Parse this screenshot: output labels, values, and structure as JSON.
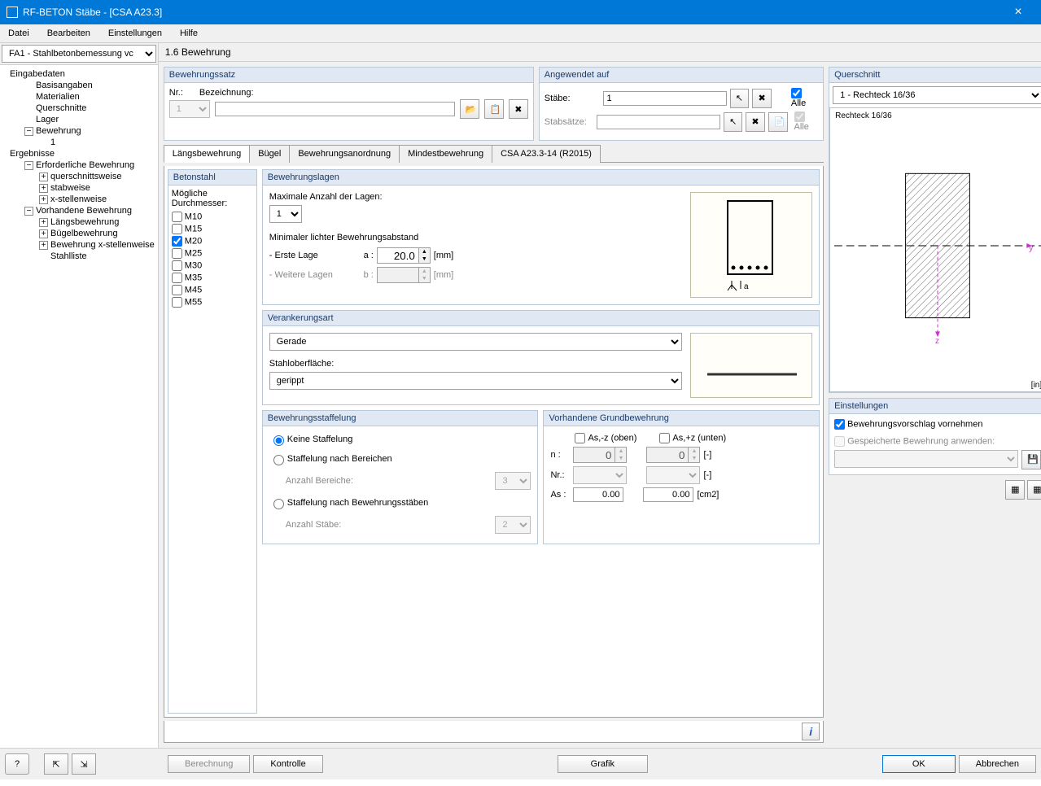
{
  "window": {
    "title": "RF-BETON Stäbe - [CSA A23.3]"
  },
  "menu": {
    "file": "Datei",
    "edit": "Bearbeiten",
    "settings": "Einstellungen",
    "help": "Hilfe"
  },
  "caseSelector": {
    "value": "FA1 - Stahlbetonbemessung vc"
  },
  "tree": {
    "eingabedaten": "Eingabedaten",
    "basisangaben": "Basisangaben",
    "materialien": "Materialien",
    "querschnitte": "Querschnitte",
    "lager": "Lager",
    "bewehrung": "Bewehrung",
    "bewehrung1": "1",
    "ergebnisse": "Ergebnisse",
    "erforderliche": "Erforderliche Bewehrung",
    "querschnittsweise": "querschnittsweise",
    "stabweise": "stabweise",
    "xstellenweise": "x-stellenweise",
    "vorhandene": "Vorhandene Bewehrung",
    "laengsbewehrung": "Längsbewehrung",
    "buegelbewehrung": "Bügelbewehrung",
    "bewxstellen": "Bewehrung x-stellenweise",
    "stahlliste": "Stahlliste"
  },
  "page": {
    "title": "1.6 Bewehrung"
  },
  "bewehrungssatz": {
    "title": "Bewehrungssatz",
    "nrLabel": "Nr.:",
    "nrValue": "1",
    "bezLabel": "Bezeichnung:",
    "bezValue": ""
  },
  "angewendet": {
    "title": "Angewendet auf",
    "staebeLabel": "Stäbe:",
    "staebeValue": "1",
    "alleLabel": "Alle",
    "stabsaetzeLabel": "Stabsätze:",
    "stabsaetzeValue": ""
  },
  "tabs": {
    "t1": "Längsbewehrung",
    "t2": "Bügel",
    "t3": "Bewehrungsanordnung",
    "t4": "Mindestbewehrung",
    "t5": "CSA A23.3-14 (R2015)"
  },
  "betonstahl": {
    "title": "Betonstahl",
    "sublabel": "Mögliche Durchmesser:",
    "items": [
      {
        "label": "M10",
        "checked": false
      },
      {
        "label": "M15",
        "checked": false
      },
      {
        "label": "M20",
        "checked": true
      },
      {
        "label": "M25",
        "checked": false
      },
      {
        "label": "M30",
        "checked": false
      },
      {
        "label": "M35",
        "checked": false
      },
      {
        "label": "M45",
        "checked": false
      },
      {
        "label": "M55",
        "checked": false
      }
    ]
  },
  "lagen": {
    "title": "Bewehrungslagen",
    "maxLabel": "Maximale Anzahl der Lagen:",
    "maxValue": "1",
    "minAbstand": "Minimaler lichter Bewehrungsabstand",
    "ersteLage": "- Erste Lage",
    "aLabel": "a :",
    "aValue": "20.0",
    "unitMm": "[mm]",
    "weitere": "- Weitere Lagen",
    "bLabel": "b :",
    "bValue": ""
  },
  "verankerung": {
    "title": "Verankerungsart",
    "value": "Gerade",
    "oberflaecheLabel": "Stahloberfläche:",
    "oberflaecheValue": "gerippt"
  },
  "staffelung": {
    "title": "Bewehrungsstaffelung",
    "keine": "Keine Staffelung",
    "bereiche": "Staffelung nach Bereichen",
    "anzahlBereiche": "Anzahl Bereiche:",
    "bereicheValue": "3",
    "staebe": "Staffelung nach Bewehrungsstäben",
    "anzahlStaebe": "Anzahl Stäbe:",
    "staebeValue": "2"
  },
  "grundbewehrung": {
    "title": "Vorhandene Grundbewehrung",
    "asOben": "As,-z (oben)",
    "asUnten": "As,+z (unten)",
    "nLabel": "n :",
    "nVal1": "0",
    "nVal2": "0",
    "dash": "[-]",
    "nrLabel": "Nr.:",
    "asLabel": "As :",
    "asVal1": "0.00",
    "asVal2": "0.00",
    "cm2": "[cm2]"
  },
  "querschnitt": {
    "title": "Querschnitt",
    "value": "1 - Rechteck 16/36",
    "label": "Rechteck 16/36",
    "unit": "[in]"
  },
  "einstellungen": {
    "title": "Einstellungen",
    "vorschlag": "Bewehrungsvorschlag vornehmen",
    "gespeicherte": "Gespeicherte Bewehrung anwenden:"
  },
  "footer": {
    "berechnung": "Berechnung",
    "kontrolle": "Kontrolle",
    "grafik": "Grafik",
    "ok": "OK",
    "abbrechen": "Abbrechen"
  }
}
